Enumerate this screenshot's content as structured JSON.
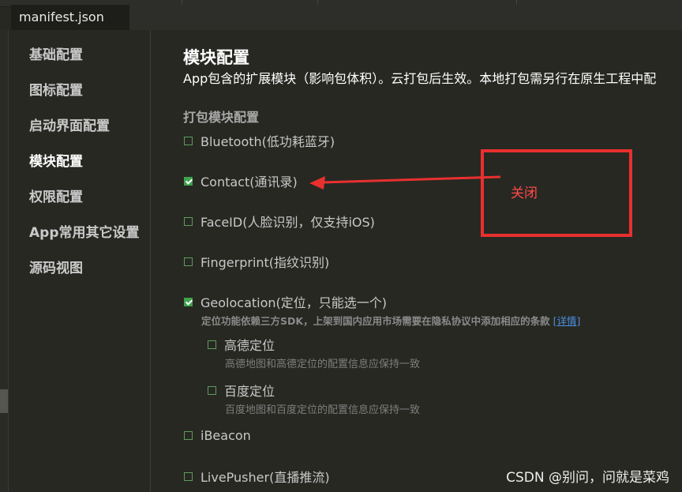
{
  "editor": {
    "tab_label": "manifest.json"
  },
  "sidebar": {
    "items": [
      {
        "label": "基础配置"
      },
      {
        "label": "图标配置"
      },
      {
        "label": "启动界面配置"
      },
      {
        "label": "模块配置",
        "active": true
      },
      {
        "label": "权限配置"
      },
      {
        "label": "App常用其它设置"
      },
      {
        "label": "源码视图"
      }
    ]
  },
  "main": {
    "title": "模块配置",
    "description": "App包含的扩展模块（影响包体积）。云打包后生效。本地打包需另行在原生工程中配",
    "section_title": "打包模块配置",
    "modules": [
      {
        "label": "Bluetooth(低功耗蓝牙)",
        "checked": false
      },
      {
        "label": "Contact(通讯录)",
        "checked": true
      },
      {
        "label": "FaceID(人脸识别，仅支持iOS)",
        "checked": false
      },
      {
        "label": "Fingerprint(指纹识别)",
        "checked": false
      },
      {
        "label": "Geolocation(定位，只能选一个)",
        "checked": true
      },
      {
        "label": "iBeacon",
        "checked": false
      },
      {
        "label": "LivePusher(直播推流)",
        "checked": false
      }
    ],
    "geolocation_note": "定位功能依赖三方SDK，上架到国内应用市场需要在隐私协议中添加相应的条款",
    "geolocation_link": "[详情]",
    "geolocation_providers": [
      {
        "label": "高德定位",
        "desc": "高德地图和高德定位的配置信息应保持一致",
        "checked": false
      },
      {
        "label": "百度定位",
        "desc": "百度地图和百度定位的配置信息应保持一致",
        "checked": false
      }
    ]
  },
  "annotation": {
    "text": "关闭",
    "color": "#e8302f"
  },
  "watermark": "CSDN @别问，问就是菜鸡",
  "colors": {
    "background": "#272822",
    "checkbox_checked": "#3fa34d",
    "link": "#4a90e2"
  }
}
